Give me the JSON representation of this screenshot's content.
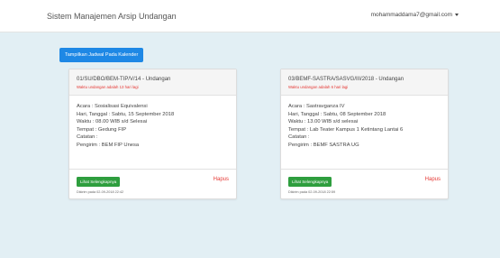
{
  "navbar": {
    "brand": "Sistem Manajemen Arsip Undangan",
    "user_email": "mohammaddama7@gmail.com"
  },
  "actions": {
    "calendar_button": "Tampilkan Jadwal Pada Kalender"
  },
  "cards": [
    {
      "title": "01/SU/DBO/BEM-TIP/V/14 - Undangan",
      "warning": "Waktu undangan adalah 13 hari lagi",
      "acara": "Acara : Sosialisasi Equivalensi",
      "hari": "Hari, Tanggal : Sabtu, 15 September 2018",
      "waktu": "Waktu : 08.00 WIB s/d Selesai",
      "tempat": "Tempat : Gedung FIP",
      "catatan": "Catatan :",
      "pengirim": "Pengirim : BEM FIP Unesa",
      "detail_button": "Lihat Selengkapnya",
      "delete_link": "Hapus",
      "posted_at": "Dikirim pada 02-09-2018 22:42"
    },
    {
      "title": "03/BEMF-SASTRA/SASVG/III/2018 - Undangan",
      "warning": "Waktu undangan adalah 6 hari lagi",
      "acara": "Acara : Sastravganza IV",
      "hari": "Hari, Tanggal : Sabtu, 08 September 2018",
      "waktu": "Waktu : 13.00 WIB s/d selesai",
      "tempat": "Tempat : Lab Teater Kampus 1 Ketintang Lantai 6",
      "catatan": "Catatan :",
      "pengirim": "Pengirim : BEMF SASTRA UG",
      "detail_button": "Lihat Selengkapnya",
      "delete_link": "Hapus",
      "posted_at": "Dikirim pada 02-09-2018 22:59"
    }
  ]
}
